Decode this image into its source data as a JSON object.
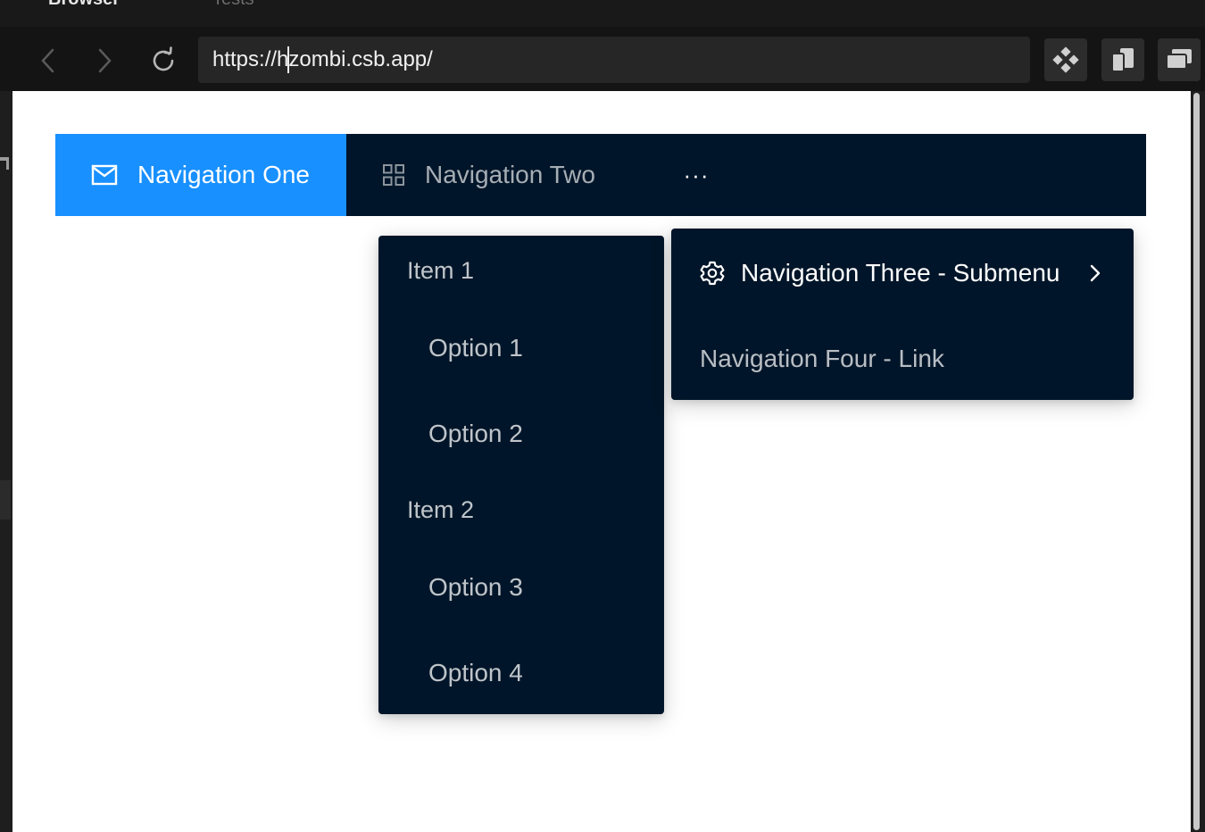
{
  "browser": {
    "tabs": [
      {
        "label": "Browser"
      },
      {
        "label": "Tests"
      }
    ],
    "url": {
      "before_caret": "https://h",
      "after_caret": "zombi.csb.app/"
    }
  },
  "menu": {
    "items": [
      {
        "label": "Navigation One",
        "icon": "mail-icon",
        "selected": true
      },
      {
        "label": "Navigation Two",
        "icon": "appstore-icon",
        "selected": false
      }
    ],
    "overflow_label": "···",
    "accent_color": "#1890ff",
    "background_color": "#001529"
  },
  "submenu_dropdown": {
    "groups": [
      {
        "title": "Item 1",
        "options": [
          "Option 1",
          "Option 2"
        ]
      },
      {
        "title": "Item 2",
        "options": [
          "Option 3",
          "Option 4"
        ]
      }
    ]
  },
  "overflow_dropdown": {
    "items": [
      {
        "label": "Navigation Three - Submenu",
        "icon": "setting-icon",
        "has_submenu": true
      },
      {
        "label": "Navigation Four - Link"
      }
    ]
  }
}
